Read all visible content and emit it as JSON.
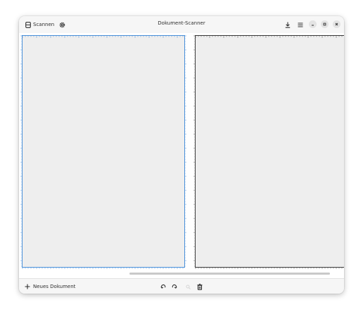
{
  "header": {
    "scan_label": "Scannen",
    "title": "Dokument-Scanner"
  },
  "footer": {
    "new_document_label": "Neues Dokument"
  },
  "icons": {
    "scan": "scanner-icon",
    "settings": "gear-icon",
    "download": "download-icon",
    "menu": "hamburger-menu-icon",
    "minimize": "minimize-icon",
    "maximize": "maximize-icon",
    "close": "close-icon",
    "new": "plus-icon",
    "undo": "undo-icon",
    "redo": "redo-icon",
    "zoom": "zoom-icon",
    "delete": "trash-icon"
  },
  "colors": {
    "selection": "#4a90d9",
    "background": "#f6f6f6"
  }
}
